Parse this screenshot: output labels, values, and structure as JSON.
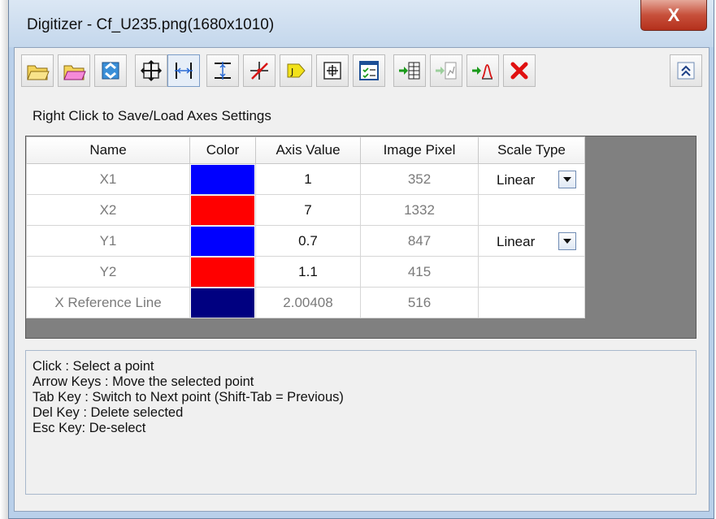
{
  "window": {
    "title": "Digitizer - Cf_U235.png(1680x1010)",
    "close_label": "X"
  },
  "toolbar": {
    "buttons": [
      {
        "name": "open-folder-icon"
      },
      {
        "name": "open-pink-folder-icon"
      },
      {
        "name": "refresh-arrows-icon"
      },
      {
        "name": "move-axes-icon"
      },
      {
        "name": "x-axis-calibrate-icon"
      },
      {
        "name": "y-axis-calibrate-icon"
      },
      {
        "name": "reference-line-icon"
      },
      {
        "name": "yellow-tag-icon"
      },
      {
        "name": "zoom-point-icon"
      },
      {
        "name": "checklist-icon"
      },
      {
        "name": "export-table-icon"
      },
      {
        "name": "export-chart-icon"
      },
      {
        "name": "peak-fit-icon"
      },
      {
        "name": "delete-icon"
      },
      {
        "name": "collapse-icon"
      }
    ]
  },
  "hint": "Right Click to Save/Load Axes Settings",
  "table": {
    "headers": [
      "Name",
      "Color",
      "Axis Value",
      "Image Pixel",
      "Scale Type"
    ],
    "rows": [
      {
        "name": "X1",
        "color": "#0000ff",
        "axis_value": "1",
        "pixel": "352",
        "scale": "Linear"
      },
      {
        "name": "X2",
        "color": "#ff0000",
        "axis_value": "7",
        "pixel": "1332",
        "scale": ""
      },
      {
        "name": "Y1",
        "color": "#0000ff",
        "axis_value": "0.7",
        "pixel": "847",
        "scale": "Linear"
      },
      {
        "name": "Y2",
        "color": "#ff0000",
        "axis_value": "1.1",
        "pixel": "415",
        "scale": ""
      },
      {
        "name": "X Reference Line",
        "color": "#000080",
        "axis_value": "2.00408",
        "pixel": "516",
        "scale": ""
      }
    ]
  },
  "help": {
    "lines": [
      "Click : Select a point",
      "Arrow Keys : Move the selected point",
      "Tab Key : Switch to Next point (Shift-Tab = Previous)",
      "Del Key : Delete selected",
      "Esc Key: De-select"
    ]
  },
  "colors": {
    "swatch_blue": "#0000ff",
    "swatch_red": "#ff0000",
    "swatch_navy": "#000080"
  }
}
